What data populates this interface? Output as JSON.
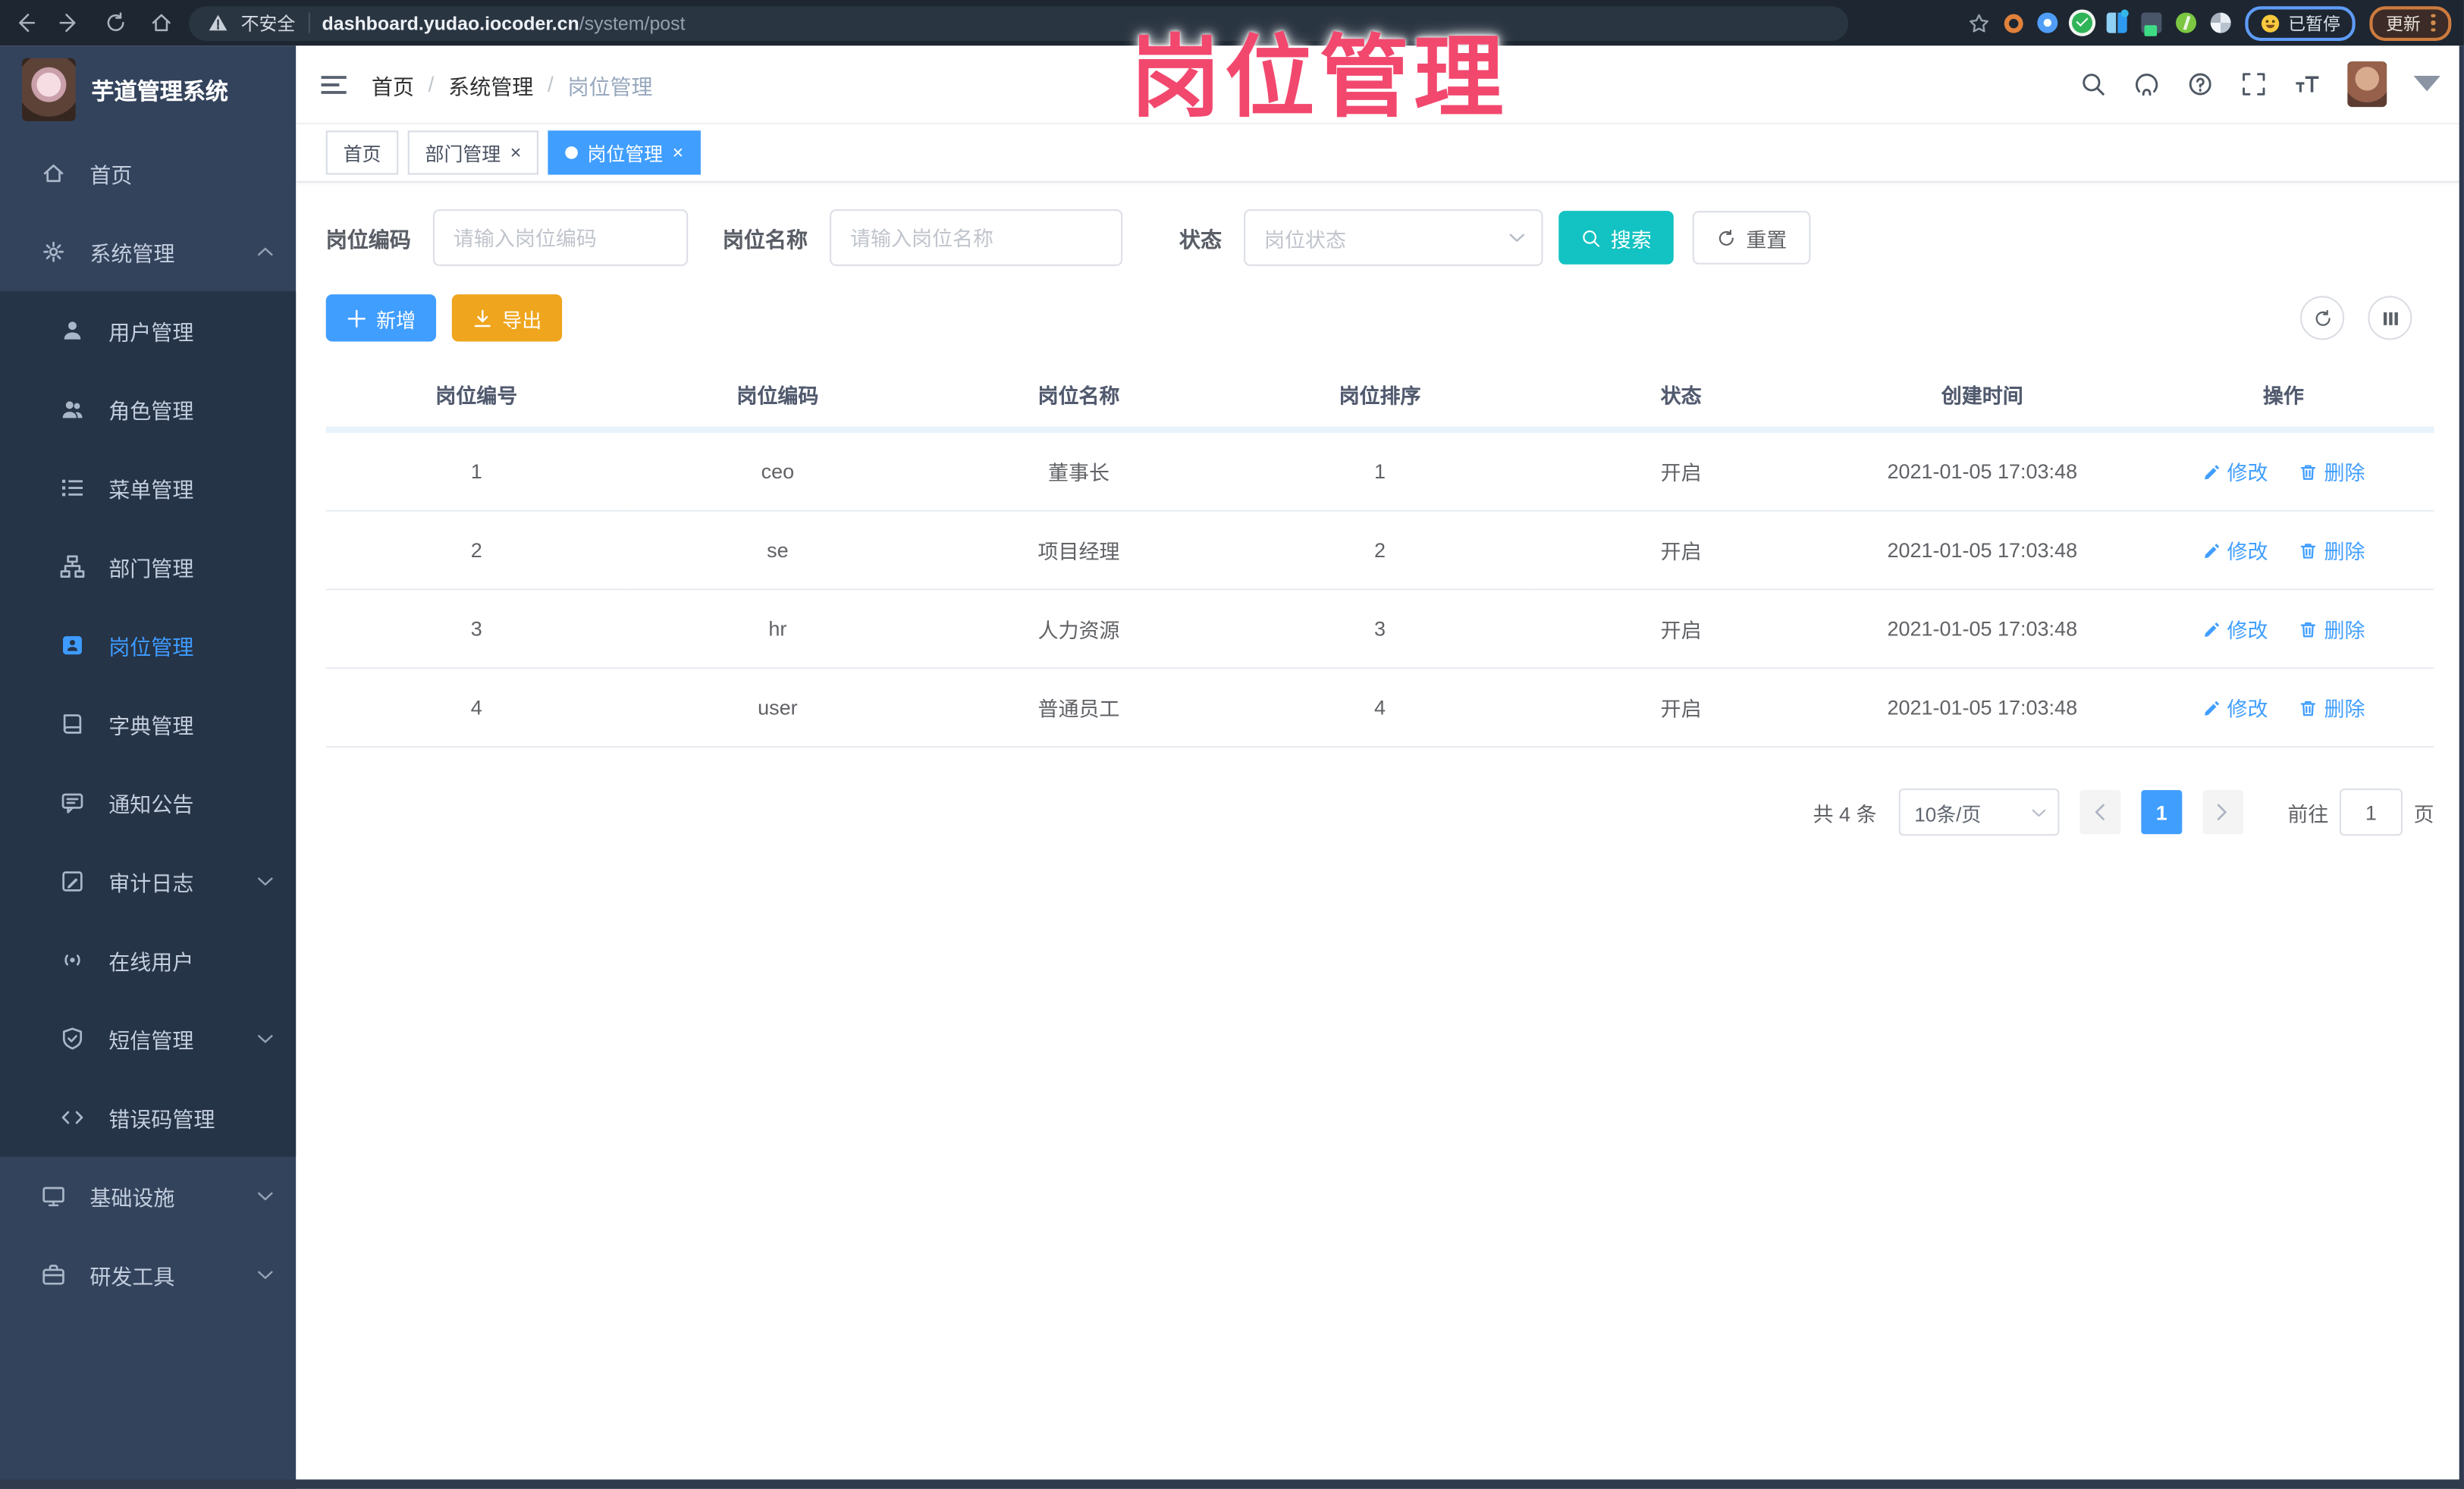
{
  "colors": {
    "accent_blue": "#409eff",
    "search_teal": "#13c2c2",
    "export_orange": "#efa51d",
    "watermark_pink": "#f2486e",
    "sidebar_bg": "#33435c",
    "submenu_bg": "#263447",
    "browser_bar_bg": "#1d2631"
  },
  "watermark": "岗位管理",
  "browser": {
    "security_label": "不安全",
    "url_domain": "dashboard.yudao.iocoder.cn",
    "url_path": "/system/post",
    "paused_label": "已暂停",
    "update_label": "更新"
  },
  "sidebar": {
    "app_title": "芋道管理系统",
    "items": [
      {
        "label": "首页"
      },
      {
        "label": "系统管理"
      },
      {
        "label": "用户管理"
      },
      {
        "label": "角色管理"
      },
      {
        "label": "菜单管理"
      },
      {
        "label": "部门管理"
      },
      {
        "label": "岗位管理"
      },
      {
        "label": "字典管理"
      },
      {
        "label": "通知公告"
      },
      {
        "label": "审计日志"
      },
      {
        "label": "在线用户"
      },
      {
        "label": "短信管理"
      },
      {
        "label": "错误码管理"
      },
      {
        "label": "基础设施"
      },
      {
        "label": "研发工具"
      }
    ]
  },
  "breadcrumb": {
    "separator": "/",
    "items": [
      "首页",
      "系统管理",
      "岗位管理"
    ]
  },
  "tabs": [
    {
      "label": "首页"
    },
    {
      "label": "部门管理",
      "close": "×"
    },
    {
      "label": "岗位管理",
      "close": "×"
    }
  ],
  "filters": {
    "code_label": "岗位编码",
    "code_placeholder": "请输入岗位编码",
    "name_label": "岗位名称",
    "name_placeholder": "请输入岗位名称",
    "status_label": "状态",
    "status_placeholder": "岗位状态",
    "search_label": "搜索",
    "reset_label": "重置"
  },
  "toolbar": {
    "add_label": "新增",
    "export_label": "导出"
  },
  "table": {
    "columns": [
      "岗位编号",
      "岗位编码",
      "岗位名称",
      "岗位排序",
      "状态",
      "创建时间",
      "操作"
    ],
    "edit_label": "修改",
    "delete_label": "删除",
    "rows": [
      {
        "id": "1",
        "code": "ceo",
        "name": "董事长",
        "sort": "1",
        "status": "开启",
        "created": "2021-01-05 17:03:48"
      },
      {
        "id": "2",
        "code": "se",
        "name": "项目经理",
        "sort": "2",
        "status": "开启",
        "created": "2021-01-05 17:03:48"
      },
      {
        "id": "3",
        "code": "hr",
        "name": "人力资源",
        "sort": "3",
        "status": "开启",
        "created": "2021-01-05 17:03:48"
      },
      {
        "id": "4",
        "code": "user",
        "name": "普通员工",
        "sort": "4",
        "status": "开启",
        "created": "2021-01-05 17:03:48"
      }
    ]
  },
  "pagination": {
    "total_text": "共 4 条",
    "page_size": "10条/页",
    "current_page": "1",
    "goto_label": "前往",
    "goto_value": "1",
    "page_unit": "页"
  }
}
